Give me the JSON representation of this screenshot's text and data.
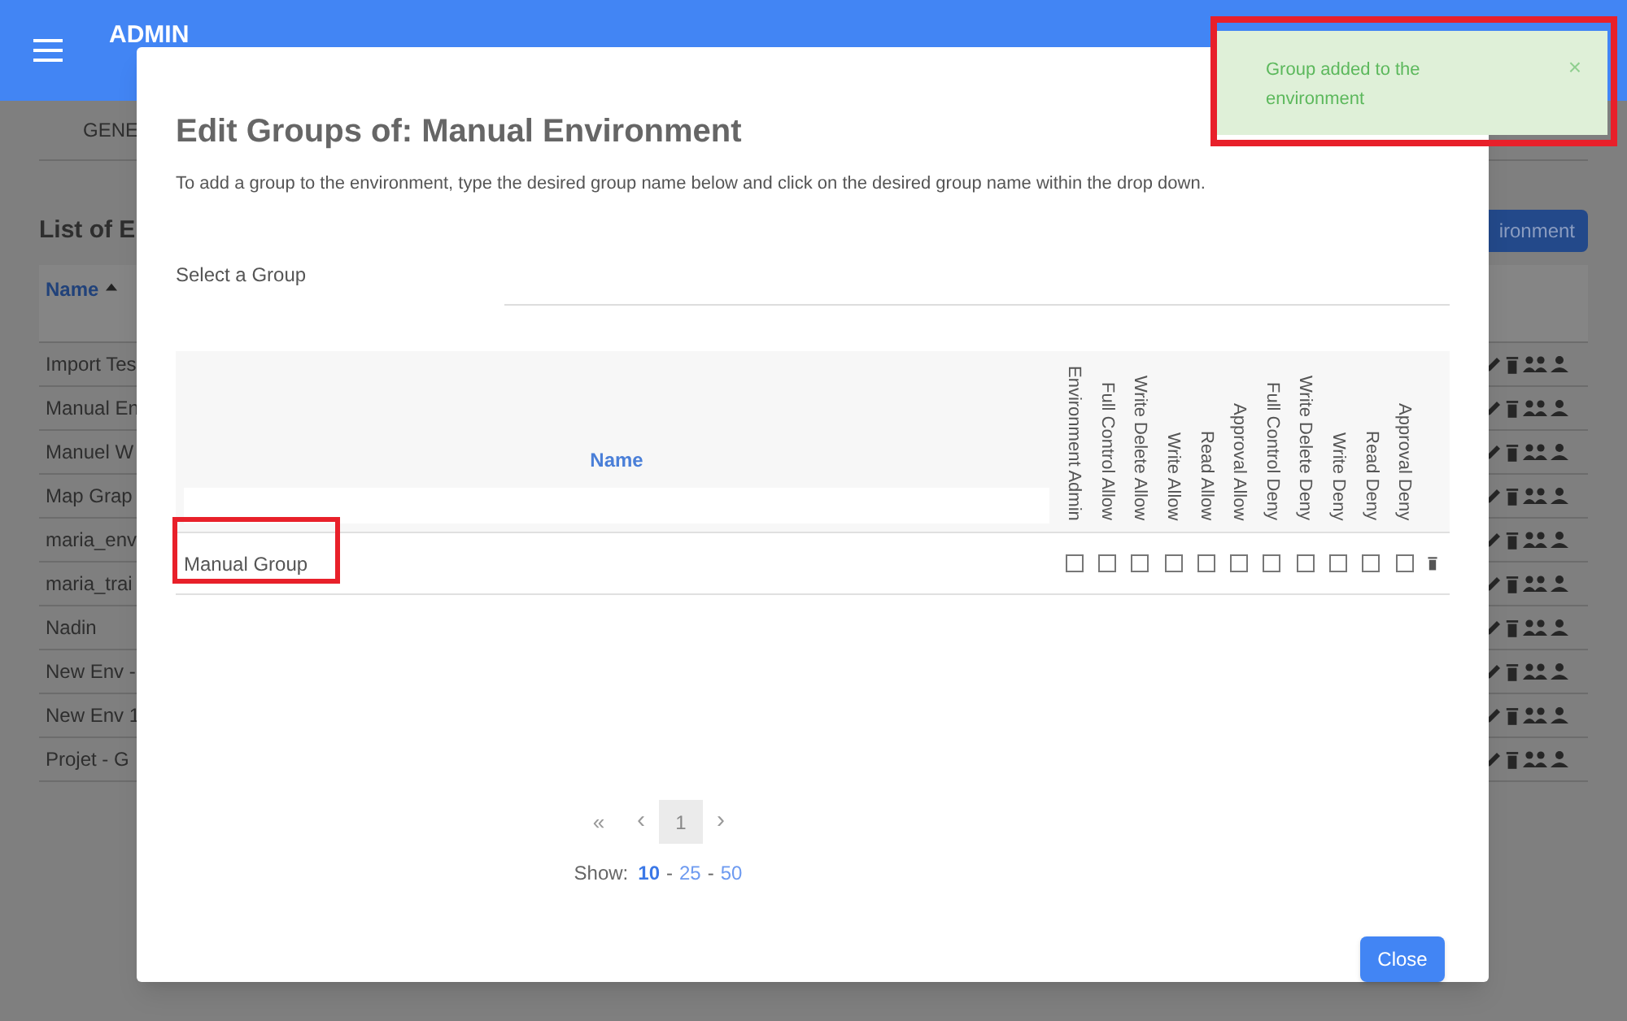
{
  "app": {
    "title": "ADMIN",
    "tab": "GENE",
    "heading": "List of E",
    "name_header": "Name",
    "add_button": "ironment",
    "rows": [
      "Import Tes",
      "Manual En",
      "Manuel W",
      "Map Grap",
      "maria_env",
      "maria_trai",
      "Nadin",
      "New Env -",
      "New Env 1",
      "Projet - G"
    ]
  },
  "dialog": {
    "title": "Edit Groups of: Manual Environment",
    "description": "To add a group to the environment, type the desired group name below and click on the desired group name within the drop down.",
    "select_label": "Select a Group",
    "table": {
      "name_header": "Name",
      "columns": [
        "Environment Admin",
        "Full Control Allow",
        "Write Delete Allow",
        "Write Allow",
        "Read Allow",
        "Approval Allow",
        "Full Control Deny",
        "Write Delete Deny",
        "Write Deny",
        "Read Deny",
        "Approval Deny"
      ],
      "rows": [
        {
          "name": "Manual Group",
          "permissions": [
            false,
            false,
            false,
            false,
            false,
            false,
            false,
            false,
            false,
            false,
            false
          ]
        }
      ]
    },
    "pager": {
      "first": "«",
      "prev": "‹",
      "next": "›",
      "pages": [
        {
          "label": "1",
          "selected": true
        }
      ]
    },
    "show_label": "Show:",
    "size_separator": "-",
    "page_sizes": [
      {
        "label": "10",
        "selected": true
      },
      {
        "label": "25",
        "selected": false
      },
      {
        "label": "50",
        "selected": false
      }
    ],
    "close": "Close"
  },
  "toast": {
    "message": "Group added to the environment",
    "close": "×"
  }
}
